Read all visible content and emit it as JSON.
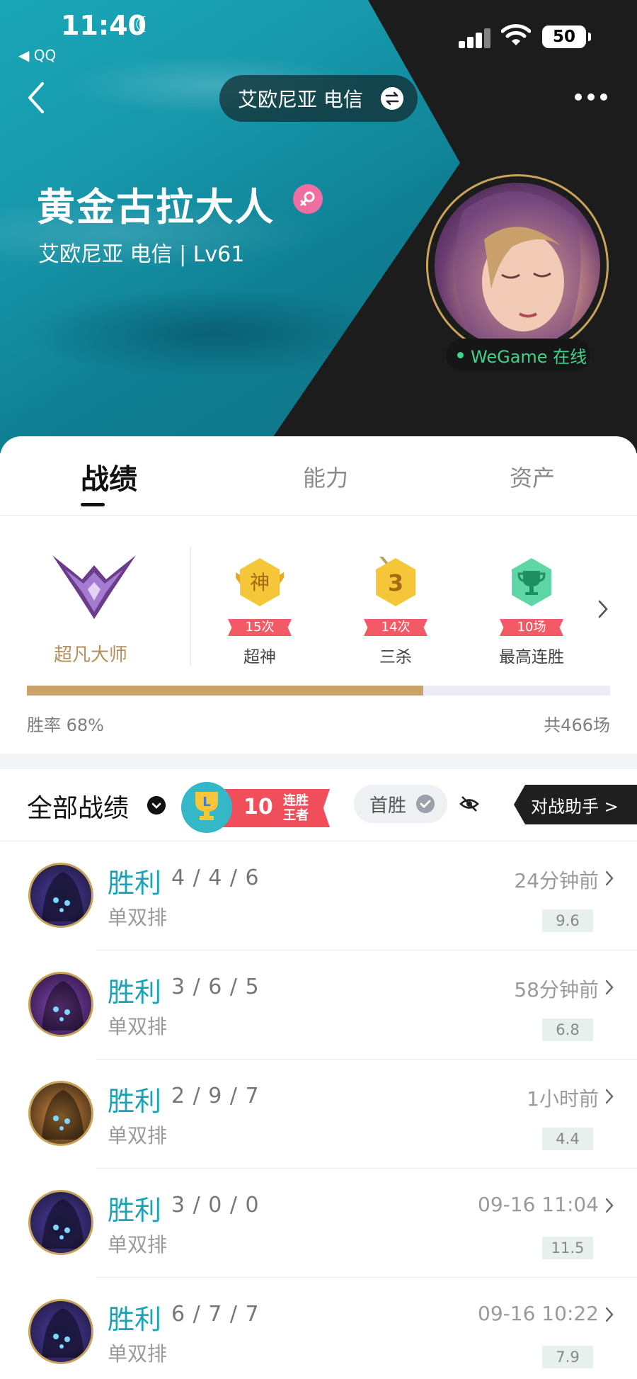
{
  "status_bar": {
    "time": "11:40",
    "back_app": "◀ QQ",
    "battery": "50"
  },
  "header": {
    "server": "艾欧尼亚 电信",
    "name": "黄金古拉大人",
    "subtitle": "艾欧尼亚 电信 | Lv61",
    "online_status": "WeGame 在线"
  },
  "tabs": [
    {
      "label": "战绩",
      "active": true
    },
    {
      "label": "能力",
      "active": false
    },
    {
      "label": "资产",
      "active": false
    }
  ],
  "stats": {
    "rank": "超凡大师",
    "achievements": [
      {
        "count": "15次",
        "label": "超神",
        "badge": "神",
        "color": "#f5c738"
      },
      {
        "count": "14次",
        "label": "三杀",
        "badge": "3",
        "color": "#f5c738"
      },
      {
        "count": "10场",
        "label": "最高连胜",
        "badge": "trophy-icon",
        "color": "#5fd6a5"
      }
    ],
    "win_rate_label": "胜率 68%",
    "win_rate": 0.68,
    "total_label": "共466场"
  },
  "records": {
    "title": "全部战绩",
    "streak_num": "10",
    "streak_line1": "连胜",
    "streak_line2": "王者",
    "first_win": "首胜",
    "helper": "对战助手 >"
  },
  "matches": [
    {
      "result": "胜利",
      "kda": "4 / 4 / 6",
      "queue": "单双排",
      "time": "24分钟前",
      "score": "9.6"
    },
    {
      "result": "胜利",
      "kda": "3 / 6 / 5",
      "queue": "单双排",
      "time": "58分钟前",
      "score": "6.8"
    },
    {
      "result": "胜利",
      "kda": "2 / 9 / 7",
      "queue": "单双排",
      "time": "1小时前",
      "score": "4.4"
    },
    {
      "result": "胜利",
      "kda": "3 / 0 / 0",
      "queue": "单双排",
      "time": "09-16 11:04",
      "score": "11.5"
    },
    {
      "result": "胜利",
      "kda": "6 / 7 / 7",
      "queue": "单双排",
      "time": "09-16 10:22",
      "score": "7.9"
    }
  ]
}
